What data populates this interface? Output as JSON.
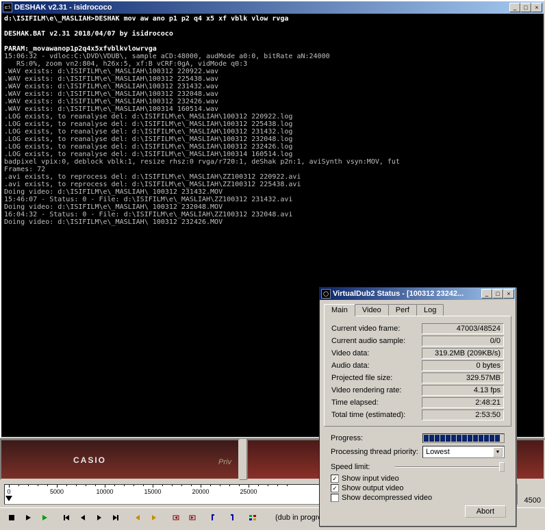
{
  "console": {
    "title": "DESHAK v2.31 - isidrococo",
    "lines": [
      "d:\\ISIFILM\\e\\_MASLIAH>DESHAK mov aw ano p1 p2 q4 x5 xf vblk vlow rvga",
      "",
      "DESHAK.BAT v2.31 2018/04/07 by isidrococo",
      "",
      "PARAM:_movawanop1p2q4x5xfvblkvlowrvga",
      "15:06:32 - vdloc:C:\\DVD\\VDUB\\, sample aCD:48000, audMode a0:0, bitRate aN:24000",
      "   RS:0%, zoom vn2:804, h26x:5, xf:B vCRF:0gA, vidMode q0:3",
      ".WAV exists: d:\\ISIFILM\\e\\_MASLIAH\\100312 220922.wav",
      ".WAV exists: d:\\ISIFILM\\e\\_MASLIAH\\100312 225438.wav",
      ".WAV exists: d:\\ISIFILM\\e\\_MASLIAH\\100312 231432.wav",
      ".WAV exists: d:\\ISIFILM\\e\\_MASLIAH\\100312 232048.wav",
      ".WAV exists: d:\\ISIFILM\\e\\_MASLIAH\\100312 232426.wav",
      ".WAV exists: d:\\ISIFILM\\e\\_MASLIAH\\100314 160514.wav",
      ".LOG exists, to reanalyse del: d:\\ISIFILM\\e\\_MASLIAH\\100312 220922.log",
      ".LOG exists, to reanalyse del: d:\\ISIFILM\\e\\_MASLIAH\\100312 225438.log",
      ".LOG exists, to reanalyse del: d:\\ISIFILM\\e\\_MASLIAH\\100312 231432.log",
      ".LOG exists, to reanalyse del: d:\\ISIFILM\\e\\_MASLIAH\\100312 232048.log",
      ".LOG exists, to reanalyse del: d:\\ISIFILM\\e\\_MASLIAH\\100312 232426.log",
      ".LOG exists, to reanalyse del: d:\\ISIFILM\\e\\_MASLIAH\\100314 160514.log",
      "badpixel vpix:0, deblock vblk:1, resize rhsz:0 rvga/r720:1, deShak p2n:1, aviSynth vsyn:MOV, fut",
      "Frames: 72",
      ".avi exists, to reprocess del: d:\\ISIFILM\\e\\_MASLIAH\\ZZ100312 220922.avi",
      ".avi exists, to reprocess del: d:\\ISIFILM\\e\\_MASLIAH\\ZZ100312 225438.avi",
      "Doing video: d:\\ISIFILM\\e\\_MASLIAH\\ 100312 231432.MOV",
      "15:46:07 - Status: 0 - File: d:\\ISIFILM\\e\\_MASLIAH\\ZZ100312 231432.avi",
      "Doing video: d:\\ISIFILM\\e\\_MASLIAH\\ 100312 232048.MOV",
      "16:04:32 - Status: 0 - File: d:\\ISIFILM\\e\\_MASLIAH\\ZZ100312 232048.avi",
      "Doing video: d:\\ISIFILM\\e\\_MASLIAH\\ 100312 232426.MOV"
    ]
  },
  "video_preview": {
    "brand": "CASIO",
    "text_fragment": "Priv"
  },
  "timeline": {
    "ticks": [
      "0",
      "5000",
      "10000",
      "15000",
      "20000",
      "25000"
    ],
    "end_label": "4500"
  },
  "toolbar": {
    "dub_status": "(dub in progress)"
  },
  "status": {
    "title": "VirtualDub2 Status - [100312 23242...",
    "tabs": [
      "Main",
      "Video",
      "Perf",
      "Log"
    ],
    "rows": [
      {
        "label": "Current video frame:",
        "value": "47003/48524"
      },
      {
        "label": "Current audio sample:",
        "value": "0/0"
      },
      {
        "label": "Video data:",
        "value": "319.2MB (209KB/s)"
      },
      {
        "label": "Audio data:",
        "value": "0 bytes"
      },
      {
        "label": "Projected file size:",
        "value": "329.57MB"
      },
      {
        "label": "Video rendering rate:",
        "value": "4.13 fps"
      },
      {
        "label": "Time elapsed:",
        "value": "2:48:21"
      },
      {
        "label": "Total time (estimated):",
        "value": "2:53:50"
      }
    ],
    "progress_label": "Progress:",
    "priority_label": "Processing thread priority:",
    "priority_value": "Lowest",
    "speed_label": "Speed limit:",
    "cb_input": "Show input video",
    "cb_output": "Show output video",
    "cb_decomp": "Show decompressed video",
    "abort": "Abort"
  }
}
